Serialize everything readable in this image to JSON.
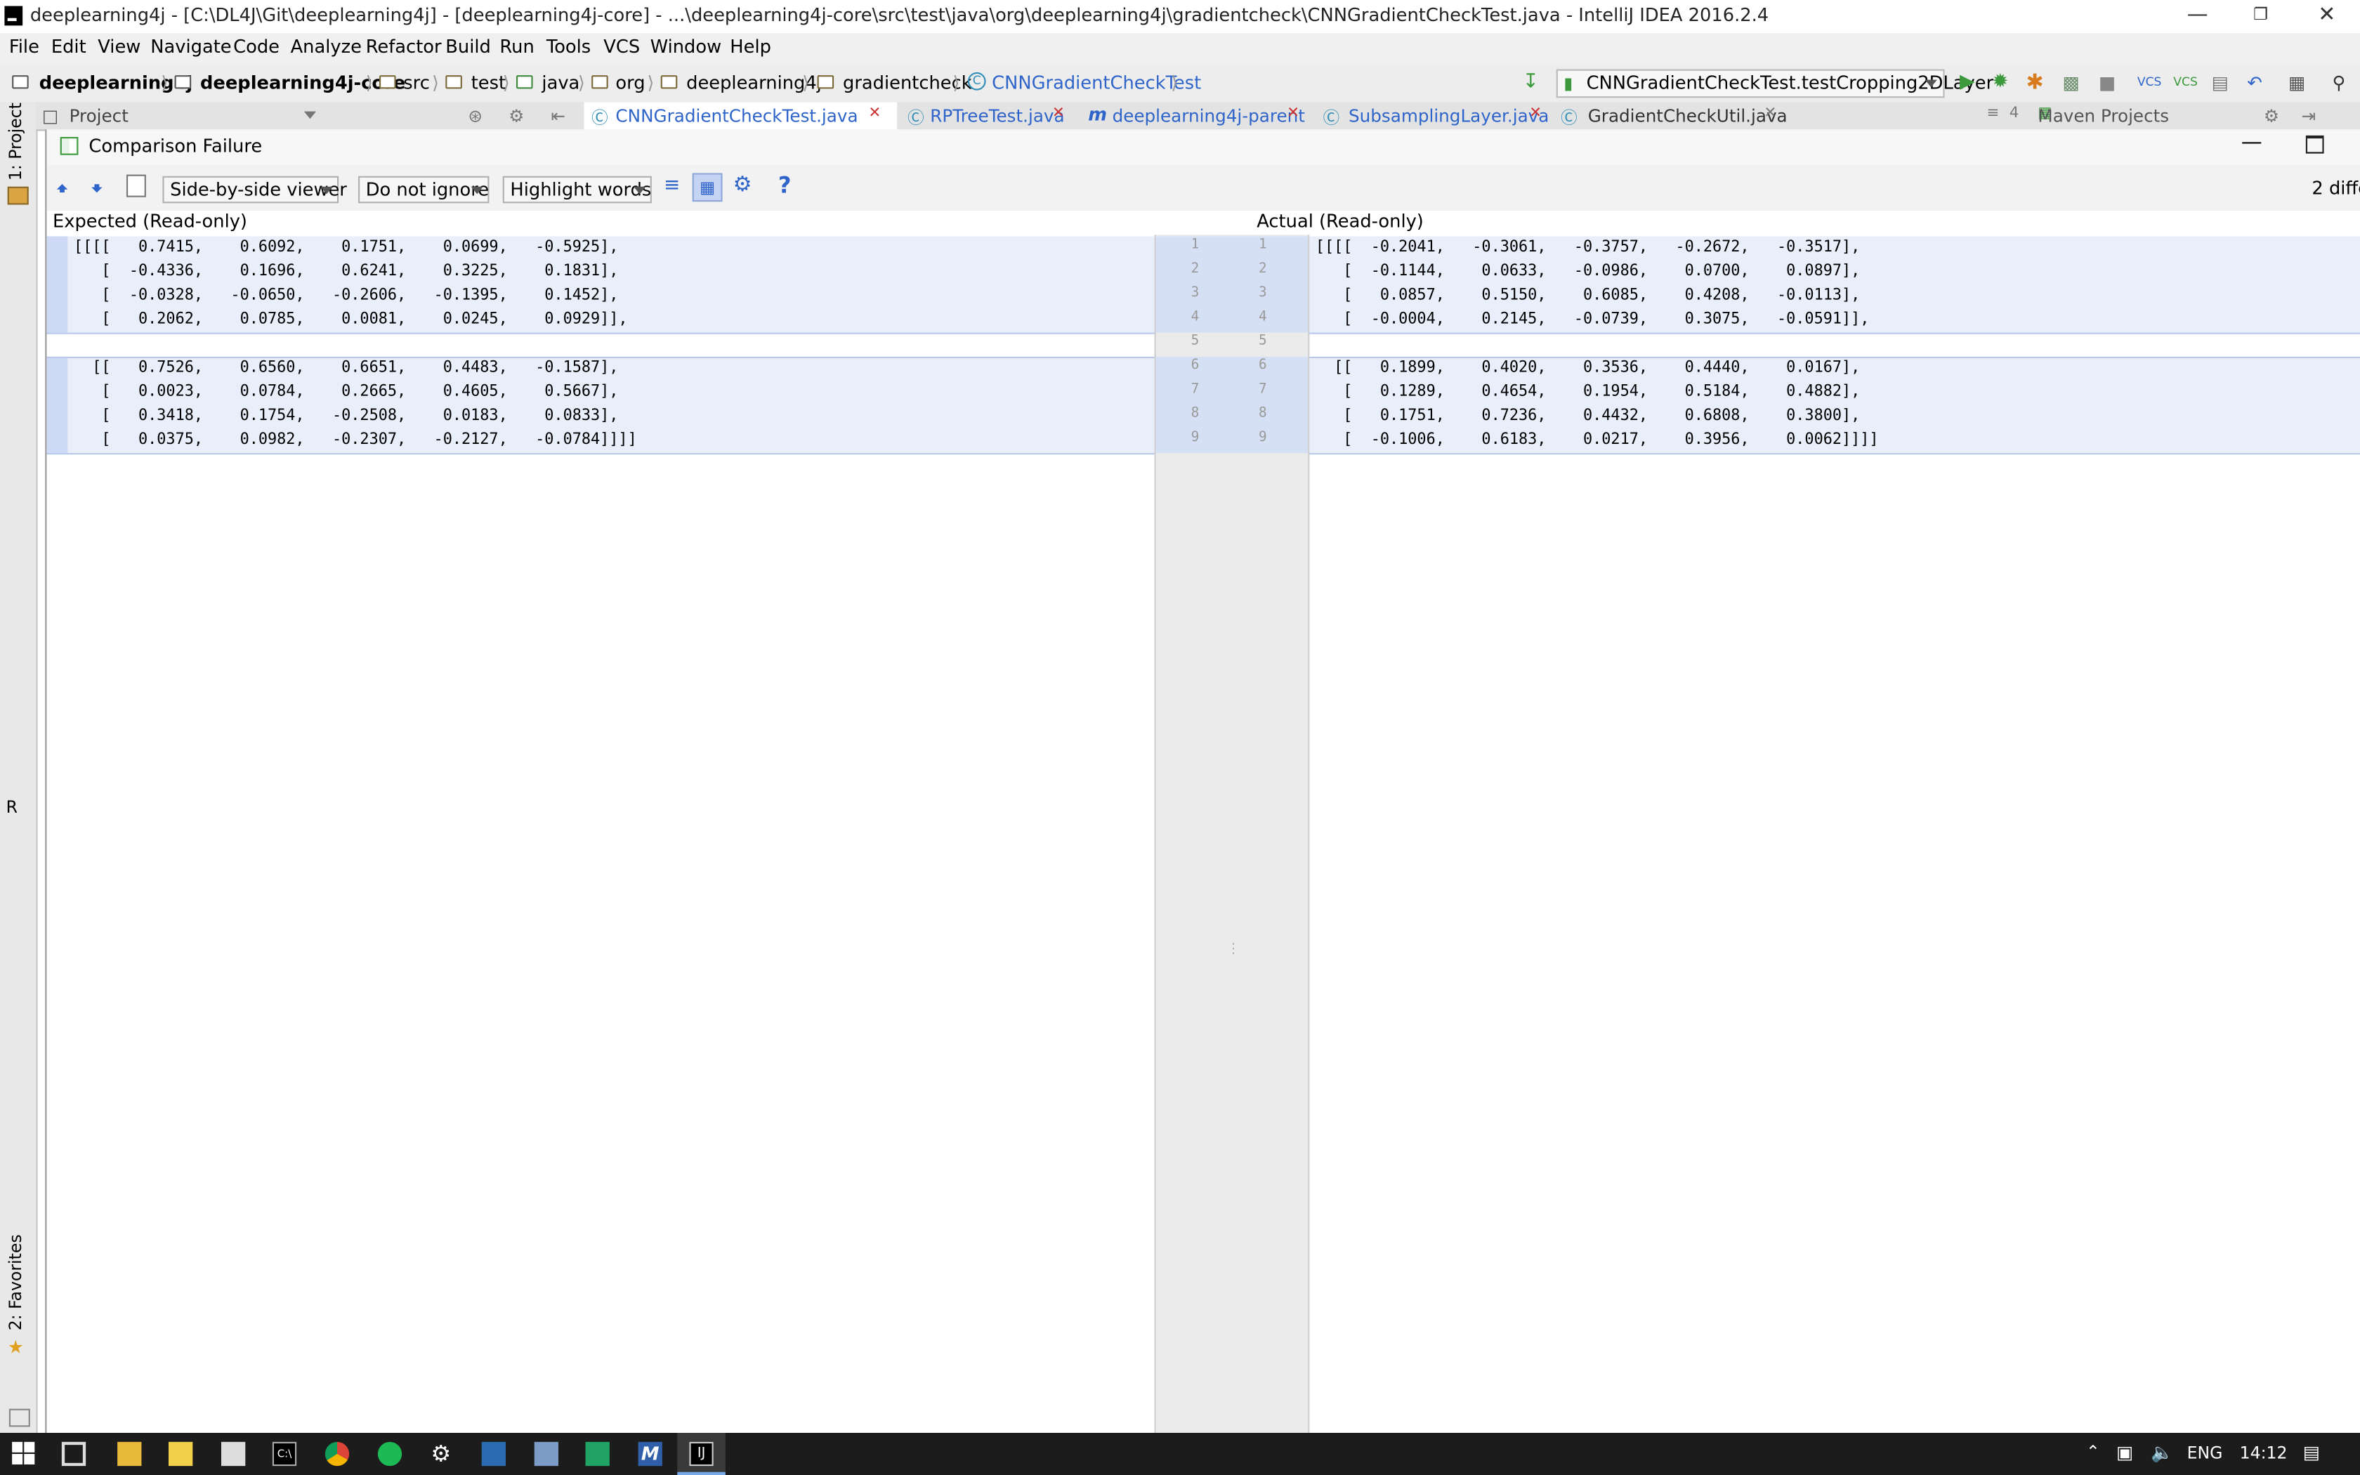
{
  "window": {
    "title": "deeplearning4j - [C:\\DL4J\\Git\\deeplearning4j] - [deeplearning4j-core] - ...\\deeplearning4j-core\\src\\test\\java\\org\\deeplearning4j\\gradientcheck\\CNNGradientCheckTest.java - IntelliJ IDEA 2016.2.4"
  },
  "menu": [
    "File",
    "Edit",
    "View",
    "Navigate",
    "Code",
    "Analyze",
    "Refactor",
    "Build",
    "Run",
    "Tools",
    "VCS",
    "Window",
    "Help"
  ],
  "breadcrumbs": [
    "deeplearning4j",
    "deeplearning4j-core",
    "src",
    "test",
    "java",
    "org",
    "deeplearning4j",
    "gradientcheck",
    "CNNGradientCheckTest"
  ],
  "run_config": "CNNGradientCheckTest.testCropping2DLayer",
  "tool_tabs": {
    "project": "Project",
    "maven": "Maven Projects",
    "left_project": "1: Project",
    "left_favorites": "2: Favorites",
    "left_r": "R"
  },
  "editor_tabs": [
    {
      "label": "CNNGradientCheckTest.java",
      "active": true
    },
    {
      "label": "RPTreeTest.java",
      "active": false
    },
    {
      "label": "deeplearning4j-parent",
      "active": false
    },
    {
      "label": "SubsamplingLayer.java",
      "active": false
    },
    {
      "label": "GradientCheckUtil.java",
      "active": false
    }
  ],
  "tab_overflow": "4",
  "dialog": {
    "title": "Comparison Failure",
    "viewer_mode": "Side-by-side viewer",
    "ignore_mode": "Do not ignore",
    "highlight_mode": "Highlight words",
    "diff_count": "2 diffe",
    "left_header": "Expected (Read-only)",
    "right_header": "Actual (Read-only)"
  },
  "expected_lines": [
    "[[[[   0.7415,    0.6092,    0.1751,    0.0699,   -0.5925],",
    "   [  -0.4336,    0.1696,    0.6241,    0.3225,    0.1831],",
    "   [  -0.0328,   -0.0650,   -0.2606,   -0.1395,    0.1452],",
    "   [   0.2062,    0.0785,    0.0081,    0.0245,    0.0929]],",
    "",
    "  [[   0.7526,    0.6560,    0.6651,    0.4483,   -0.1587],",
    "   [   0.0023,    0.0784,    0.2665,    0.4605,    0.5667],",
    "   [   0.3418,    0.1754,   -0.2508,    0.0183,    0.0833],",
    "   [   0.0375,    0.0982,   -0.2307,   -0.2127,   -0.0784]]]]"
  ],
  "actual_lines": [
    "[[[[  -0.2041,   -0.3061,   -0.3757,   -0.2672,   -0.3517],",
    "   [  -0.1144,    0.0633,   -0.0986,    0.0700,    0.0897],",
    "   [   0.0857,    0.5150,    0.6085,    0.4208,   -0.0113],",
    "   [  -0.0004,    0.2145,   -0.0739,    0.3075,   -0.0591]],",
    "",
    "  [[   0.1899,    0.4020,    0.3536,    0.4440,    0.0167],",
    "   [   0.1289,    0.4654,    0.1954,    0.5184,    0.4882],",
    "   [   0.1751,    0.7236,    0.4432,    0.6808,    0.3800],",
    "   [  -0.1006,    0.6183,    0.0217,    0.3956,    0.0062]]]]"
  ],
  "line_numbers": [
    "1",
    "2",
    "3",
    "4",
    "5",
    "6",
    "7",
    "8",
    "9"
  ],
  "taskbar": {
    "language": "ENG",
    "time": "14:12"
  },
  "colors": {
    "diff_changed_bg": "#e8effb",
    "diff_word_bg": "#cdd9f5",
    "gutter_bg": "#ebebeb",
    "taskbar_bg": "#1c1c1c",
    "accent_blue": "#2f65ca",
    "run_green": "#3c9a3c"
  }
}
